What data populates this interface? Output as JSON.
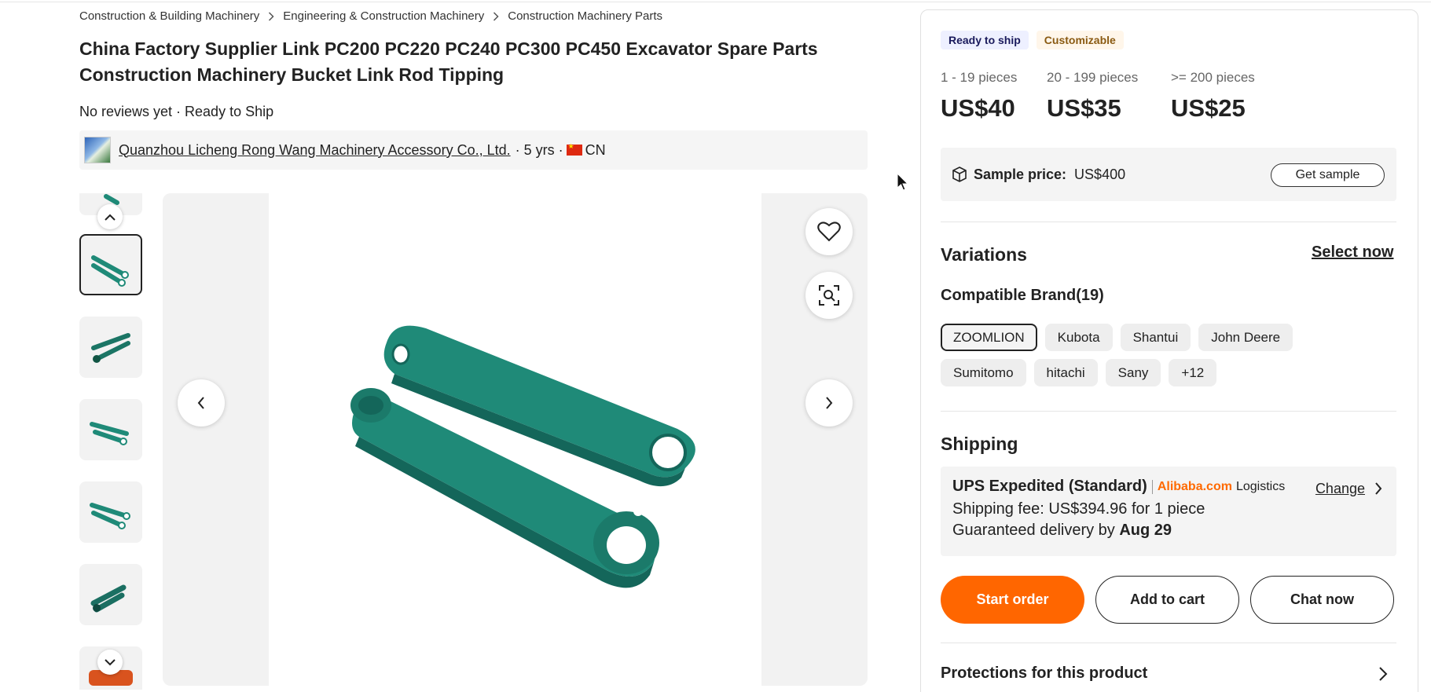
{
  "breadcrumb": [
    "Construction & Building Machinery",
    "Engineering & Construction Machinery",
    "Construction Machinery Parts"
  ],
  "product": {
    "title": "China Factory Supplier Link PC200 PC220 PC240 PC300 PC450 Excavator Spare Parts Construction Machinery Bucket Link Rod Tipping",
    "subline": "No reviews yet · Ready to Ship"
  },
  "supplier": {
    "name": "Quanzhou Licheng Rong Wang Machinery Accessory Co., Ltd.",
    "years": "· 5 yrs ·",
    "country": "CN"
  },
  "badges": {
    "ready": "Ready to ship",
    "custom": "Customizable"
  },
  "price_tiers": [
    {
      "qty": "1 - 19 pieces",
      "price": "US$40"
    },
    {
      "qty": "20 - 199 pieces",
      "price": "US$35"
    },
    {
      "qty": ">= 200 pieces",
      "price": "US$25"
    }
  ],
  "sample": {
    "label": "Sample price:",
    "price": "US$400",
    "button": "Get sample"
  },
  "variations": {
    "title": "Variations",
    "select_now": "Select now",
    "brand_label": "Compatible Brand(19)",
    "brands": [
      "ZOOMLION",
      "Kubota",
      "Shantui",
      "John Deere",
      "Sumitomo",
      "hitachi",
      "Sany",
      "+12"
    ]
  },
  "shipping": {
    "title": "Shipping",
    "method": "UPS Expedited (Standard)",
    "brand": "Alibaba.com",
    "logistics": "Logistics",
    "change": "Change",
    "fee": "Shipping fee: US$394.96 for 1 piece",
    "delivery_prefix": "Guaranteed delivery by",
    "delivery_date": "Aug 29"
  },
  "actions": {
    "start_order": "Start order",
    "add_cart": "Add to cart",
    "chat": "Chat now"
  },
  "protections": "Protections for this product",
  "colors": {
    "accent": "#ff6600",
    "product_green": "#1f8a78"
  },
  "icons": [
    "chevron-right-icon",
    "chevron-up-icon",
    "chevron-down-icon",
    "chevron-left-icon",
    "heart-icon",
    "image-search-icon",
    "box-icon",
    "cursor-icon"
  ]
}
